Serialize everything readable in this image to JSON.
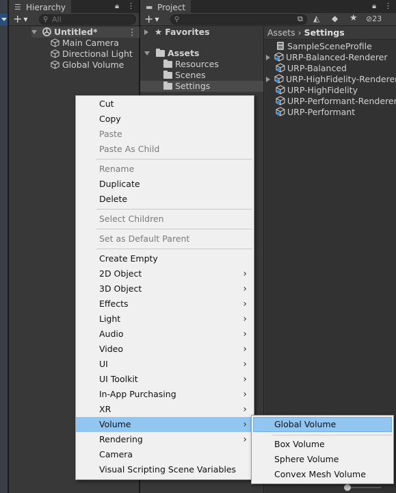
{
  "hierarchy": {
    "tab_label": "Hierarchy",
    "search_placeholder": "All",
    "scene_name": "Untitled*",
    "items": [
      "Main Camera",
      "Directional Light",
      "Global Volume"
    ]
  },
  "project": {
    "tab_label": "Project",
    "asset_count": "23",
    "tree": {
      "favorites": "Favorites",
      "assets": "Assets",
      "folders": [
        "Resources",
        "Scenes",
        "Settings"
      ]
    },
    "breadcrumb": [
      "Assets",
      "Settings"
    ],
    "assets": [
      "SampleSceneProfile",
      "URP-Balanced-Renderer",
      "URP-Balanced",
      "URP-HighFidelity-Renderer",
      "URP-HighFidelity",
      "URP-Performant-Renderer",
      "URP-Performant"
    ]
  },
  "context_menu": {
    "items": [
      {
        "label": "Cut"
      },
      {
        "label": "Copy"
      },
      {
        "label": "Paste"
      },
      {
        "label": "Paste As Child"
      },
      {
        "label": "Rename"
      },
      {
        "label": "Duplicate"
      },
      {
        "label": "Delete"
      },
      {
        "label": "Select Children"
      },
      {
        "label": "Set as Default Parent"
      },
      {
        "label": "Create Empty"
      },
      {
        "label": "2D Object"
      },
      {
        "label": "3D Object"
      },
      {
        "label": "Effects"
      },
      {
        "label": "Light"
      },
      {
        "label": "Audio"
      },
      {
        "label": "Video"
      },
      {
        "label": "UI"
      },
      {
        "label": "UI Toolkit"
      },
      {
        "label": "In-App Purchasing"
      },
      {
        "label": "XR"
      },
      {
        "label": "Volume"
      },
      {
        "label": "Rendering"
      },
      {
        "label": "Camera"
      },
      {
        "label": "Visual Scripting Scene Variables"
      }
    ]
  },
  "volume_submenu": {
    "items": [
      "Global Volume",
      "Box Volume",
      "Sphere Volume",
      "Convex Mesh Volume"
    ]
  },
  "colors": {
    "menu_highlight": "#92c5ef",
    "panel_bg": "#383838",
    "menu_bg": "#f0f0f0"
  }
}
